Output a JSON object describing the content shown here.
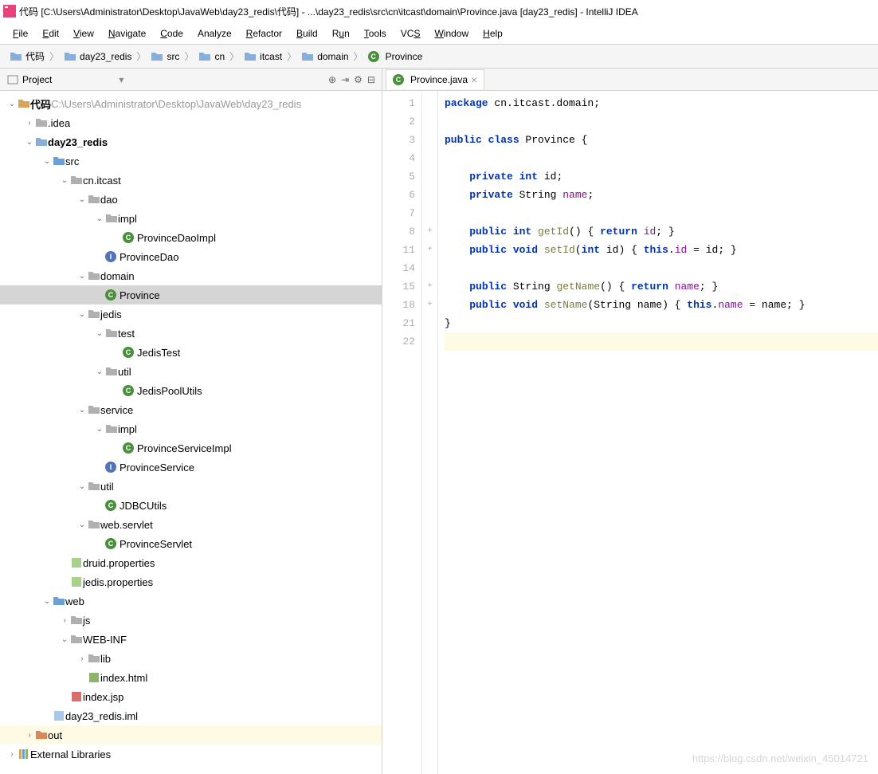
{
  "title": "代码 [C:\\Users\\Administrator\\Desktop\\JavaWeb\\day23_redis\\代码] - ...\\day23_redis\\src\\cn\\itcast\\domain\\Province.java [day23_redis] - IntelliJ IDEA",
  "menu": [
    "File",
    "Edit",
    "View",
    "Navigate",
    "Code",
    "Analyze",
    "Refactor",
    "Build",
    "Run",
    "Tools",
    "VCS",
    "Window",
    "Help"
  ],
  "menu_mn": [
    "F",
    "E",
    "V",
    "N",
    "C",
    "",
    "R",
    "B",
    "u",
    "T",
    "S",
    "W",
    "H"
  ],
  "breadcrumbs": [
    {
      "icon": "folder",
      "label": "代码"
    },
    {
      "icon": "module",
      "label": "day23_redis"
    },
    {
      "icon": "folder",
      "label": "src"
    },
    {
      "icon": "folder",
      "label": "cn"
    },
    {
      "icon": "folder",
      "label": "itcast"
    },
    {
      "icon": "folder",
      "label": "domain"
    },
    {
      "icon": "class",
      "label": "Province"
    }
  ],
  "project_label": "Project",
  "toolbar_icons": [
    "target",
    "expand",
    "gear",
    "hide"
  ],
  "tree": [
    {
      "d": 0,
      "a": "v",
      "i": "folder-open",
      "t": "代码",
      "suffix": " C:\\Users\\Administrator\\Desktop\\JavaWeb\\day23_redis",
      "bold": true
    },
    {
      "d": 1,
      "a": ">",
      "i": "folder",
      "t": ".idea"
    },
    {
      "d": 1,
      "a": "v",
      "i": "module",
      "t": "day23_redis",
      "bold": true
    },
    {
      "d": 2,
      "a": "v",
      "i": "src",
      "t": "src"
    },
    {
      "d": 3,
      "a": "v",
      "i": "package",
      "t": "cn.itcast"
    },
    {
      "d": 4,
      "a": "v",
      "i": "package",
      "t": "dao"
    },
    {
      "d": 5,
      "a": "v",
      "i": "package",
      "t": "impl"
    },
    {
      "d": 6,
      "a": "",
      "i": "class-c",
      "t": "ProvinceDaoImpl"
    },
    {
      "d": 5,
      "a": "",
      "i": "class-i",
      "t": "ProvinceDao"
    },
    {
      "d": 4,
      "a": "v",
      "i": "package",
      "t": "domain"
    },
    {
      "d": 5,
      "a": "",
      "i": "class-c",
      "t": "Province",
      "sel": true
    },
    {
      "d": 4,
      "a": "v",
      "i": "package",
      "t": "jedis"
    },
    {
      "d": 5,
      "a": "v",
      "i": "package",
      "t": "test"
    },
    {
      "d": 6,
      "a": "",
      "i": "class-c",
      "t": "JedisTest",
      "badge": "j"
    },
    {
      "d": 5,
      "a": "v",
      "i": "package",
      "t": "util"
    },
    {
      "d": 6,
      "a": "",
      "i": "class-c",
      "t": "JedisPoolUtils"
    },
    {
      "d": 4,
      "a": "v",
      "i": "package",
      "t": "service"
    },
    {
      "d": 5,
      "a": "v",
      "i": "package",
      "t": "impl"
    },
    {
      "d": 6,
      "a": "",
      "i": "class-c",
      "t": "ProvinceServiceImpl"
    },
    {
      "d": 5,
      "a": "",
      "i": "class-i",
      "t": "ProvinceService"
    },
    {
      "d": 4,
      "a": "v",
      "i": "package",
      "t": "util"
    },
    {
      "d": 5,
      "a": "",
      "i": "class-c",
      "t": "JDBCUtils"
    },
    {
      "d": 4,
      "a": "v",
      "i": "package",
      "t": "web.servlet"
    },
    {
      "d": 5,
      "a": "",
      "i": "class-c",
      "t": "ProvinceServlet"
    },
    {
      "d": 3,
      "a": "",
      "i": "prop",
      "t": "druid.properties"
    },
    {
      "d": 3,
      "a": "",
      "i": "prop",
      "t": "jedis.properties"
    },
    {
      "d": 2,
      "a": "v",
      "i": "webfolder",
      "t": "web"
    },
    {
      "d": 3,
      "a": ">",
      "i": "folder",
      "t": "js"
    },
    {
      "d": 3,
      "a": "v",
      "i": "folder",
      "t": "WEB-INF"
    },
    {
      "d": 4,
      "a": ">",
      "i": "folder",
      "t": "lib"
    },
    {
      "d": 4,
      "a": "",
      "i": "html",
      "t": "index.html"
    },
    {
      "d": 3,
      "a": "",
      "i": "jsp",
      "t": "index.jsp"
    },
    {
      "d": 2,
      "a": "",
      "i": "iml",
      "t": "day23_redis.iml"
    },
    {
      "d": 1,
      "a": ">",
      "i": "folder-out",
      "t": "out",
      "hl": true
    },
    {
      "d": 0,
      "a": ">",
      "i": "lib",
      "t": "External Libraries"
    }
  ],
  "tab": {
    "label": "Province.java"
  },
  "gutter": [
    "1",
    "2",
    "3",
    "4",
    "5",
    "6",
    "7",
    "8",
    "11",
    "14",
    "15",
    "18",
    "21",
    "22"
  ],
  "fold": [
    "",
    "",
    "",
    "",
    "",
    "",
    "",
    "+",
    "+",
    "",
    "+",
    "+",
    "",
    ""
  ],
  "code": {
    "l1": {
      "pkg": "package",
      "path": " cn.itcast.domain;"
    },
    "l3": {
      "a": "public class",
      "b": " Province {"
    },
    "l5": {
      "a": "private int",
      "b": " id;"
    },
    "l6": {
      "a": "private",
      "b": " String ",
      "c": "name",
      ";": ";"
    },
    "l8": {
      "a": "public int ",
      "m": "getId",
      "b": "() { ",
      "r": "return ",
      "f": "id",
      "e": "; }"
    },
    "l11": {
      "a": "public void ",
      "m": "setId",
      "b": "(",
      "k": "int",
      "c": " id) { ",
      "t": "this",
      "d": ".",
      "f": "id",
      "e": " = id; }"
    },
    "l15": {
      "a": "public",
      "b": " String ",
      "m": "getName",
      "c": "() { ",
      "r": "return ",
      "f": "name",
      "e": "; }"
    },
    "l18": {
      "a": "public void ",
      "m": "setName",
      "b": "(String name) { ",
      "t": "this",
      "d": ".",
      "f": "name",
      "e": " = name; }"
    },
    "l21": "}"
  },
  "watermark": "https://blog.csdn.net/weixin_45014721"
}
